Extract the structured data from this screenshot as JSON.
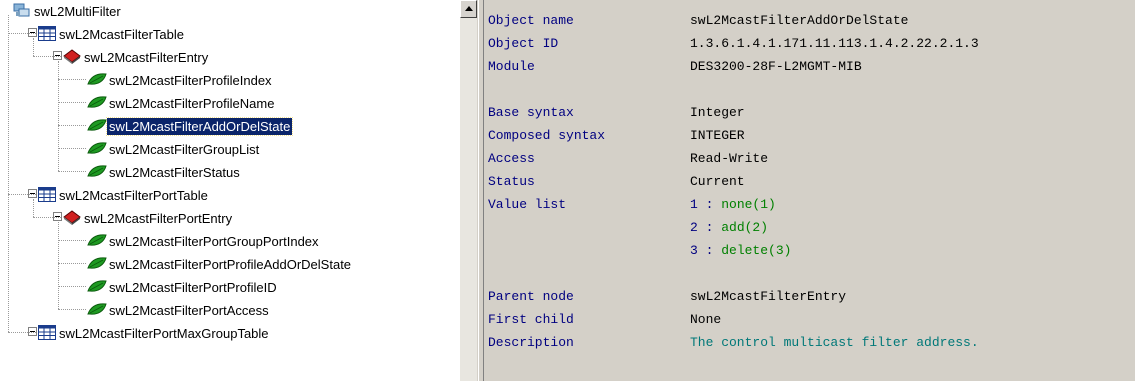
{
  "tree": {
    "nodes": [
      {
        "label": "swL2MultiFilter",
        "level": 0,
        "icon": "network-icon",
        "expander": false,
        "selected": false
      },
      {
        "label": "swL2McastFilterTable",
        "level": 1,
        "icon": "table-icon",
        "expander": true,
        "selected": false
      },
      {
        "label": "swL2McastFilterEntry",
        "level": 2,
        "icon": "entry-icon",
        "expander": true,
        "selected": false
      },
      {
        "label": "swL2McastFilterProfileIndex",
        "level": 3,
        "icon": "leaf-icon",
        "expander": false,
        "selected": false
      },
      {
        "label": "swL2McastFilterProfileName",
        "level": 3,
        "icon": "leaf-icon",
        "expander": false,
        "selected": false
      },
      {
        "label": "swL2McastFilterAddOrDelState",
        "level": 3,
        "icon": "leaf-icon",
        "expander": false,
        "selected": true
      },
      {
        "label": "swL2McastFilterGroupList",
        "level": 3,
        "icon": "leaf-icon",
        "expander": false,
        "selected": false
      },
      {
        "label": "swL2McastFilterStatus",
        "level": 3,
        "icon": "leaf-icon",
        "expander": false,
        "selected": false
      },
      {
        "label": "swL2McastFilterPortTable",
        "level": 1,
        "icon": "table-icon",
        "expander": true,
        "selected": false
      },
      {
        "label": "swL2McastFilterPortEntry",
        "level": 2,
        "icon": "entry-icon",
        "expander": true,
        "selected": false
      },
      {
        "label": "swL2McastFilterPortGroupPortIndex",
        "level": 3,
        "icon": "leaf-icon",
        "expander": false,
        "selected": false
      },
      {
        "label": "swL2McastFilterPortProfileAddOrDelState",
        "level": 3,
        "icon": "leaf-icon",
        "expander": false,
        "selected": false
      },
      {
        "label": "swL2McastFilterPortProfileID",
        "level": 3,
        "icon": "leaf-icon",
        "expander": false,
        "selected": false
      },
      {
        "label": "swL2McastFilterPortAccess",
        "level": 3,
        "icon": "leaf-icon",
        "expander": false,
        "selected": false
      },
      {
        "label": "swL2McastFilterPortMaxGroupTable",
        "level": 1,
        "icon": "table-icon",
        "expander": true,
        "selected": false
      }
    ]
  },
  "detail": {
    "object_name": {
      "key": "Object name",
      "value": "swL2McastFilterAddOrDelState"
    },
    "object_id": {
      "key": "Object ID",
      "value": "1.3.6.1.4.1.171.11.113.1.4.2.22.2.1.3"
    },
    "module": {
      "key": "Module",
      "value": "DES3200-28F-L2MGMT-MIB"
    },
    "base_syntax": {
      "key": "Base syntax",
      "value": "Integer"
    },
    "composed_syntax": {
      "key": "Composed syntax",
      "value": "INTEGER"
    },
    "access": {
      "key": "Access",
      "value": "Read-Write"
    },
    "status": {
      "key": "Status",
      "value": "Current"
    },
    "value_list": {
      "key": "Value list",
      "items": [
        {
          "num": "1 :",
          "label": "none(1)"
        },
        {
          "num": "2 :",
          "label": "add(2)"
        },
        {
          "num": "3 :",
          "label": "delete(3)"
        }
      ]
    },
    "parent_node": {
      "key": "Parent node",
      "value": "swL2McastFilterEntry"
    },
    "first_child": {
      "key": "First child",
      "value": "None"
    },
    "description": {
      "key": "Description",
      "value": "The control multicast filter address."
    }
  },
  "colors": {
    "detail_background": "#d4d0c8",
    "key_text": "#000080",
    "value_list_label": "#008000",
    "description_text": "#007878",
    "selection_background": "#0a246a"
  }
}
